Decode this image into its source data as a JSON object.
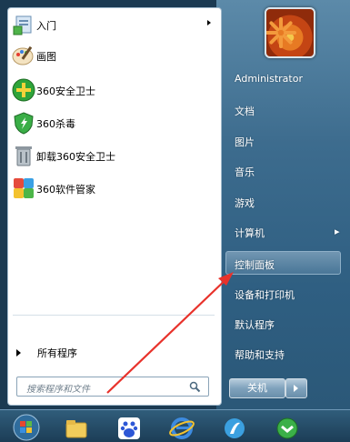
{
  "left_menu": {
    "programs": [
      {
        "label": "入门",
        "icon": "getting-started-icon",
        "has_submenu": true
      },
      {
        "label": "画图",
        "icon": "paint-icon",
        "has_submenu": false
      },
      {
        "label": "360安全卫士",
        "icon": "360-safe-guard-icon",
        "has_submenu": false
      },
      {
        "label": "360杀毒",
        "icon": "360-antivirus-icon",
        "has_submenu": false
      },
      {
        "label": "卸载360安全卫士",
        "icon": "uninstall-icon",
        "has_submenu": false
      },
      {
        "label": "360软件管家",
        "icon": "360-software-manager-icon",
        "has_submenu": false
      }
    ],
    "all_programs": "所有程序",
    "search_placeholder": "搜索程序和文件"
  },
  "right_menu": {
    "user": "Administrator",
    "items": [
      {
        "label": "文档"
      },
      {
        "label": "图片"
      },
      {
        "label": "音乐"
      },
      {
        "label": "游戏"
      },
      {
        "label": "计算机",
        "has_submenu": true
      },
      {
        "label": "控制面板",
        "highlighted": true
      },
      {
        "label": "设备和打印机"
      },
      {
        "label": "默认程序"
      },
      {
        "label": "帮助和支持"
      }
    ],
    "shutdown": "关机"
  },
  "taskbar": {
    "icons": [
      "start-orb-icon",
      "file-explorer-icon",
      "baidu-icon",
      "internet-explorer-icon",
      "browser-icon",
      "360-browser-icon"
    ]
  },
  "colors": {
    "annotation_arrow": "#e8322b",
    "highlight": "#8fb0c8"
  }
}
